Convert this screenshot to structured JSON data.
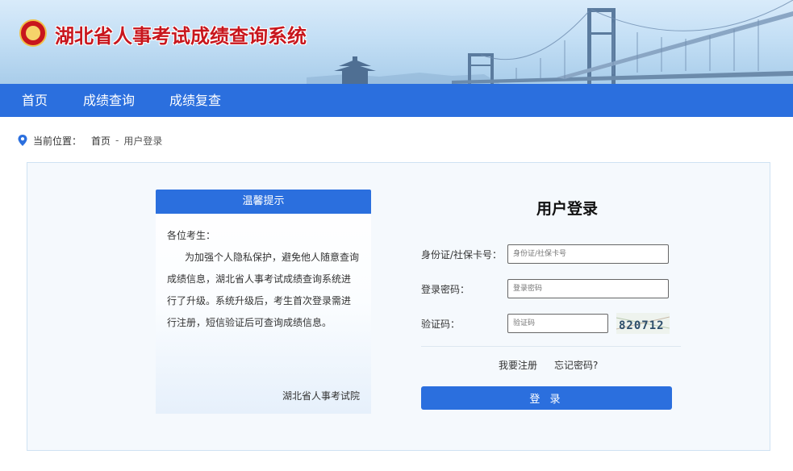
{
  "header": {
    "site_title": "湖北省人事考试成绩查询系统",
    "colors": {
      "title_red": "#c8161d",
      "nav_blue": "#2b6fde"
    }
  },
  "nav": {
    "items": [
      {
        "label": "首页"
      },
      {
        "label": "成绩查询"
      },
      {
        "label": "成绩复查"
      }
    ]
  },
  "breadcrumb": {
    "icon": "location-pin-icon",
    "prefix": "当前位置：",
    "home": "首页",
    "separator": "-",
    "current": "用户登录"
  },
  "notice": {
    "header": "温馨提示",
    "greeting": "各位考生：",
    "body": "为加强个人隐私保护，避免他人随意查询成绩信息，湖北省人事考试成绩查询系统进行了升级。系统升级后，考生首次登录需进行注册，短信验证后可查询成绩信息。",
    "signature": "湖北省人事考试院"
  },
  "login": {
    "title": "用户登录",
    "id_label": "身份证/社保卡号：",
    "id_placeholder": "身份证/社保卡号",
    "password_label": "登录密码：",
    "password_placeholder": "登录密码",
    "captcha_label": "验证码：",
    "captcha_placeholder": "验证码",
    "captcha_text": "820712",
    "register_link": "我要注册",
    "forgot_link": "忘记密码?",
    "submit_label": "登 录"
  }
}
